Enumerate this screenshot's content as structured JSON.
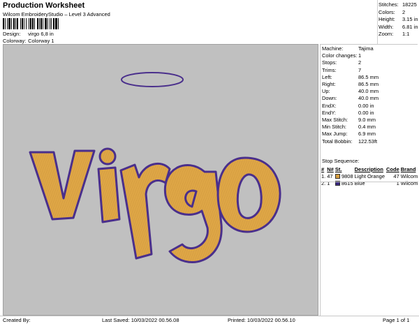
{
  "header": {
    "title": "Production Worksheet",
    "subtitle": "Wilcom EmbroideryStudio – Level 3 Advanced",
    "design_label": "Design:",
    "design_value": "virgo 6,8 in",
    "colorway_label": "Colorway:",
    "colorway_value": "Colorway 1"
  },
  "stats": [
    {
      "label": "Stitches:",
      "value": "18225"
    },
    {
      "label": "Colors:",
      "value": "2"
    },
    {
      "label": "Height:",
      "value": "3.15 in"
    },
    {
      "label": "Width:",
      "value": "6.81 in"
    },
    {
      "label": "Zoom:",
      "value": "1:1"
    }
  ],
  "machine_info": [
    {
      "label": "Machine:",
      "value": "Tajima"
    },
    {
      "label": "Color changes:",
      "value": "1"
    },
    {
      "label": "Stops:",
      "value": "2"
    },
    {
      "label": "Trims:",
      "value": "7"
    },
    {
      "label": "Left:",
      "value": "86.5 mm"
    },
    {
      "label": "Right:",
      "value": "86.5 mm"
    },
    {
      "label": "Up:",
      "value": "40.0 mm"
    },
    {
      "label": "Down:",
      "value": "40.0 mm"
    },
    {
      "label": "EndX:",
      "value": "0.00 in"
    },
    {
      "label": "EndY:",
      "value": "0.00 in"
    },
    {
      "label": "Max Stitch:",
      "value": "9.0 mm"
    },
    {
      "label": "Min Stitch:",
      "value": "0.4 mm"
    },
    {
      "label": "Max Jump:",
      "value": "6.9 mm"
    },
    {
      "label": "Total Bobbin:",
      "value": "122.53ft"
    }
  ],
  "stop_sequence": {
    "title": "Stop Sequence:",
    "columns": [
      "#",
      "N#",
      "St.",
      "Description",
      "Code",
      "Brand"
    ],
    "rows": [
      {
        "num": "1.",
        "n": "47",
        "color": "#d9a040",
        "st": "9808",
        "desc": "Light Orange",
        "code": "47",
        "brand": "Wilcom"
      },
      {
        "num": "2.",
        "n": "1",
        "color": "#3a2a80",
        "st": "8615",
        "desc": "Blue",
        "code": "1",
        "brand": "Wilcom"
      }
    ]
  },
  "design_text": "VIRGO",
  "colors": {
    "fill": "#dea646",
    "outline": "#4a2f8c",
    "canvas": "#c0c0c0"
  },
  "footer": {
    "created": "Created By:",
    "saved": "Last Saved: 10/03/2022 00.56.08",
    "printed": "Printed: 10/03/2022 00.56.10",
    "page": "Page 1 of 1"
  }
}
